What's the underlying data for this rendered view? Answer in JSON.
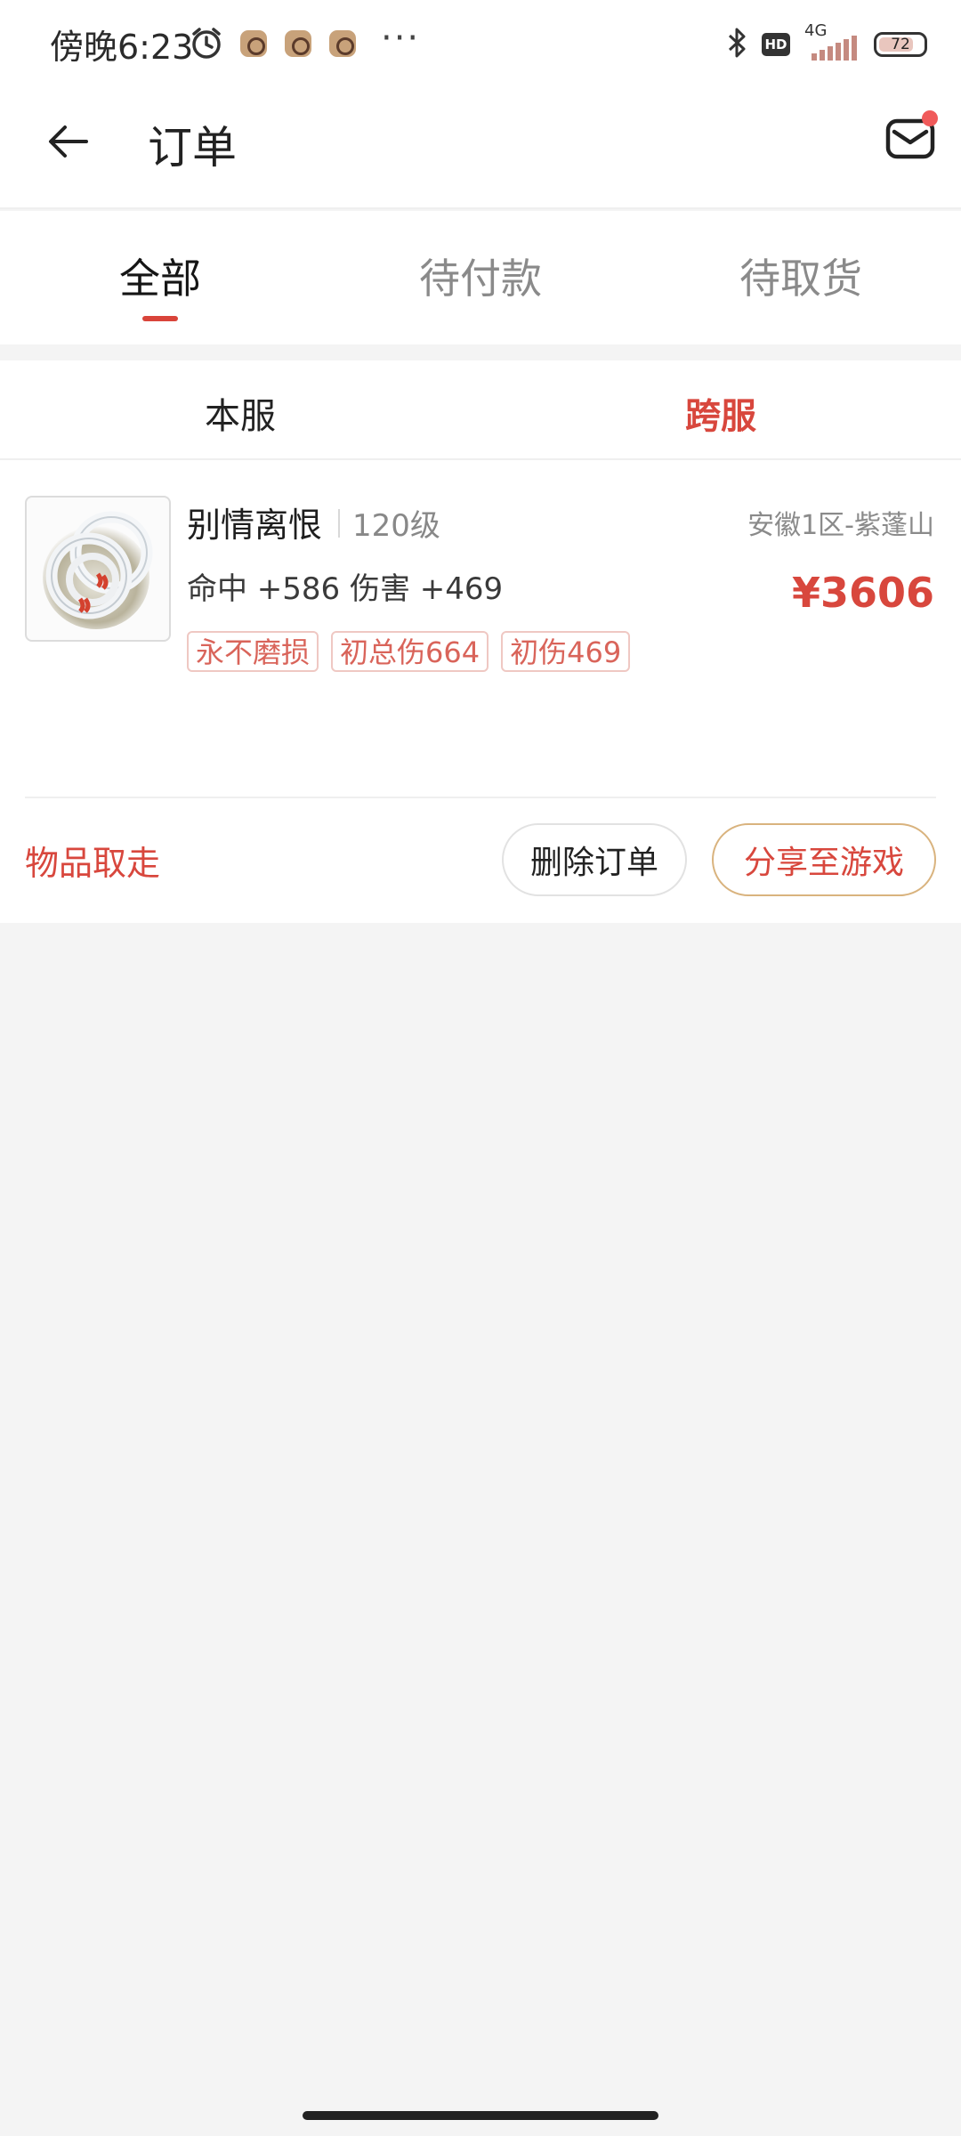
{
  "status_bar": {
    "time": "傍晚6:23",
    "network": "4G",
    "hd": "HD",
    "battery": "72",
    "more": "···"
  },
  "header": {
    "title": "订单"
  },
  "tabs": [
    {
      "label": "全部",
      "active": true
    },
    {
      "label": "待付款",
      "active": false
    },
    {
      "label": "待取货",
      "active": false
    }
  ],
  "subtabs": [
    {
      "label": "本服",
      "active": false
    },
    {
      "label": "跨服",
      "active": true
    }
  ],
  "order": {
    "item_name": "别情离恨",
    "level": "120级",
    "server": "安徽1区-紫蓬山",
    "stats": "命中 +586 伤害 +469",
    "price": "¥3606",
    "tags": [
      "永不磨损",
      "初总伤664",
      "初伤469"
    ],
    "status": "物品取走",
    "delete_label": "删除订单",
    "share_label": "分享至游戏"
  },
  "colors": {
    "accent": "#d8473d",
    "tag_border": "#efc8c3",
    "share_border": "#d9b37e",
    "background": "#f4f4f4"
  }
}
